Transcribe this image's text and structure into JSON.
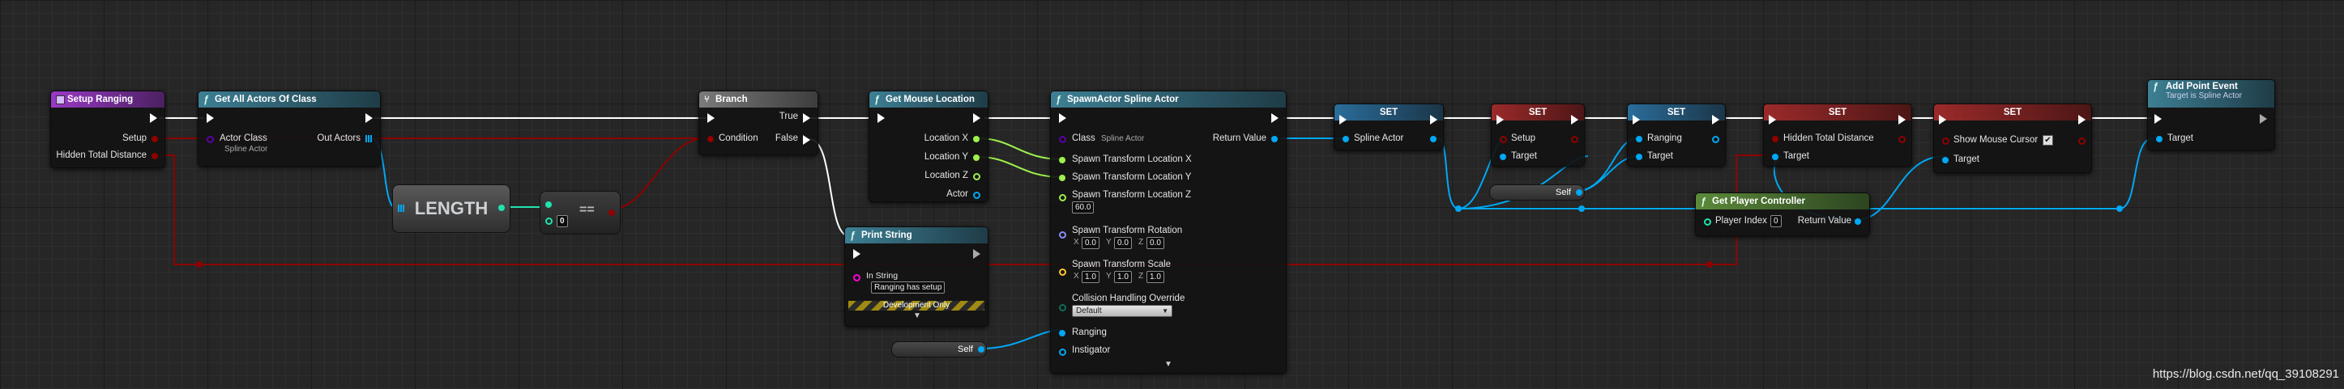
{
  "colors": {
    "exec": "#ffffff",
    "bool": "#8f0000",
    "object": "#00a8f4",
    "float": "#9ef04c",
    "class": "#5a00a8",
    "int": "#1fe3b0",
    "string": "#ff00d6",
    "enum": "#0b6e57"
  },
  "nodes": {
    "setup_ranging": {
      "title": "Setup Ranging",
      "setup": "Setup",
      "hidden_total": "Hidden Total Distance"
    },
    "get_all_actors": {
      "title": "Get All Actors Of Class",
      "actor_class": "Actor Class",
      "actor_class_value": "Spline Actor",
      "out_actors": "Out Actors"
    },
    "length": {
      "title": "LENGTH"
    },
    "equal": {
      "value": "0",
      "op": "=="
    },
    "branch": {
      "title": "Branch",
      "condition": "Condition",
      "true": "True",
      "false": "False"
    },
    "print_string": {
      "title": "Print String",
      "in_string": "In String",
      "value": "Ranging has setup",
      "footer": "Development Only"
    },
    "self_1": {
      "label": "Self"
    },
    "get_mouse": {
      "title": "Get Mouse Location",
      "loc_x": "Location X",
      "loc_y": "Location Y",
      "loc_z": "Location Z",
      "actor": "Actor"
    },
    "spawn": {
      "title": "SpawnActor Spline Actor",
      "class": "Class",
      "class_value": "Spline Actor",
      "return_value": "Return Value",
      "tx": "Spawn Transform Location X",
      "ty": "Spawn Transform Location Y",
      "tz": "Spawn Transform Location Z",
      "tz_value": "60.0",
      "rot": "Spawn Transform Rotation",
      "rot_x": "0.0",
      "rot_y": "0.0",
      "rot_z": "0.0",
      "scale": "Spawn Transform Scale",
      "scale_x": "1.0",
      "scale_y": "1.0",
      "scale_z": "1.0",
      "collision": "Collision Handling Override",
      "collision_value": "Default",
      "ranging": "Ranging",
      "instigator": "Instigator",
      "axis_x": "X",
      "axis_y": "Y",
      "axis_z": "Z"
    },
    "set1": {
      "title": "SET",
      "pin": "Spline Actor"
    },
    "set2": {
      "title": "SET",
      "setup": "Setup",
      "target": "Target"
    },
    "self_2": {
      "label": "Self"
    },
    "set3": {
      "title": "SET",
      "ranging": "Ranging",
      "target": "Target"
    },
    "set4": {
      "title": "SET",
      "hidden": "Hidden Total Distance",
      "target": "Target"
    },
    "set5": {
      "title": "SET",
      "show": "Show Mouse Cursor",
      "target": "Target",
      "checked": "✔"
    },
    "get_player": {
      "title": "Get Player Controller",
      "player_index": "Player Index",
      "player_index_value": "0",
      "return_value": "Return Value"
    },
    "add_point": {
      "title": "Add Point Event",
      "subtitle": "Target is Spline Actor",
      "target": "Target"
    }
  },
  "watermark": "https://blog.csdn.net/qq_39108291"
}
